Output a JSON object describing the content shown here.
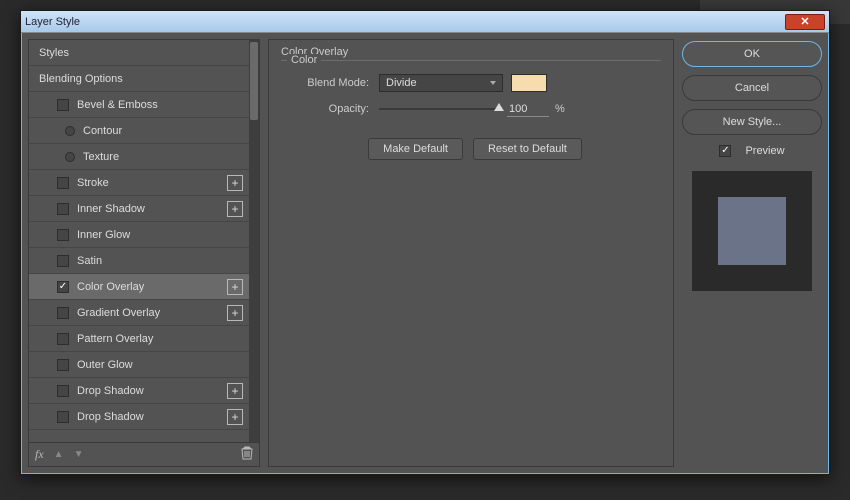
{
  "dialog": {
    "title": "Layer Style"
  },
  "sidebar": {
    "items": [
      {
        "label": "Styles",
        "kind": "header"
      },
      {
        "label": "Blending Options",
        "kind": "header"
      },
      {
        "label": "Bevel & Emboss",
        "kind": "check",
        "checked": false,
        "indent": "sub"
      },
      {
        "label": "Contour",
        "kind": "radio",
        "indent": "nested"
      },
      {
        "label": "Texture",
        "kind": "radio",
        "indent": "nested"
      },
      {
        "label": "Stroke",
        "kind": "check",
        "checked": false,
        "indent": "sub",
        "plus": true
      },
      {
        "label": "Inner Shadow",
        "kind": "check",
        "checked": false,
        "indent": "sub",
        "plus": true
      },
      {
        "label": "Inner Glow",
        "kind": "check",
        "checked": false,
        "indent": "sub"
      },
      {
        "label": "Satin",
        "kind": "check",
        "checked": false,
        "indent": "sub"
      },
      {
        "label": "Color Overlay",
        "kind": "check",
        "checked": true,
        "indent": "sub",
        "plus": true,
        "selected": true
      },
      {
        "label": "Gradient Overlay",
        "kind": "check",
        "checked": false,
        "indent": "sub",
        "plus": true
      },
      {
        "label": "Pattern Overlay",
        "kind": "check",
        "checked": false,
        "indent": "sub"
      },
      {
        "label": "Outer Glow",
        "kind": "check",
        "checked": false,
        "indent": "sub"
      },
      {
        "label": "Drop Shadow",
        "kind": "check",
        "checked": false,
        "indent": "sub",
        "plus": true
      },
      {
        "label": "Drop Shadow",
        "kind": "check",
        "checked": false,
        "indent": "sub",
        "plus": true
      }
    ],
    "footer": {
      "fx": "fx"
    }
  },
  "panel": {
    "title": "Color Overlay",
    "group_label": "Color",
    "blend_mode_label": "Blend Mode:",
    "blend_mode_value": "Divide",
    "color_swatch": "#f7dcae",
    "opacity_label": "Opacity:",
    "opacity_value": "100",
    "opacity_unit": "%",
    "make_default": "Make Default",
    "reset_default": "Reset to Default"
  },
  "actions": {
    "ok": "OK",
    "cancel": "Cancel",
    "new_style": "New Style...",
    "preview_label": "Preview",
    "preview_checked": true
  }
}
